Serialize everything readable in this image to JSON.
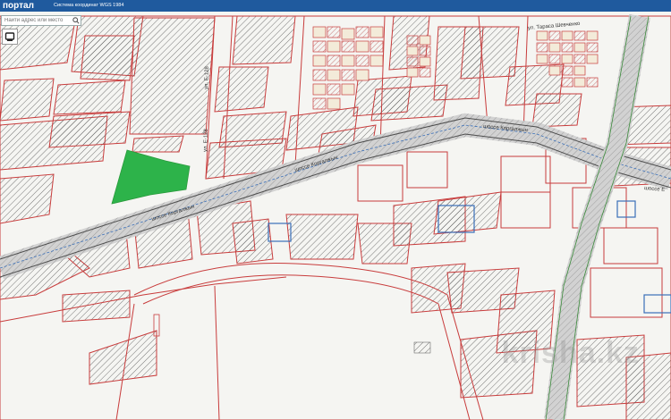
{
  "header": {
    "app_title": "портал",
    "coordinate_system": "Система координат WGS 1984"
  },
  "search": {
    "placeholder": "Найти адрес или место",
    "icon": "search-icon"
  },
  "layers_button": {
    "icon": "layers-icon"
  },
  "map": {
    "streets": {
      "e128_a": "ул. Е-128",
      "e128_b": "ул. Е-128",
      "korgalzhyn_a": "шоссе Коргалжын",
      "korgalzhyn_b": "шоссе Коргалжын",
      "korgalzhyn_c": "шоссе Коргалжын",
      "shevchenko": "ул. Тараса Шевченко",
      "right_edge": "шоссе Е"
    },
    "colors": {
      "parcel_outline": "#c83c3c",
      "highlight_parcel": "#2db34a",
      "blue_parcel": "#3a6fb8",
      "hatch": "#444444",
      "road": "#9a9a9a"
    }
  },
  "watermark": "krisha.kz"
}
